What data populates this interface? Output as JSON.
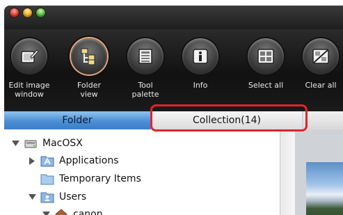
{
  "toolbar": {
    "buttons": [
      {
        "label_line1": "Edit image",
        "label_line2": "window",
        "icon": "edit-image-icon"
      },
      {
        "label_line1": "Folder",
        "label_line2": "view",
        "icon": "folder-view-icon"
      },
      {
        "label_line1": "Tool",
        "label_line2": "palette",
        "icon": "tool-palette-icon"
      },
      {
        "label_line1": "Info",
        "label_line2": "",
        "icon": "info-icon"
      },
      {
        "label_line1": "Select all",
        "label_line2": "",
        "icon": "select-all-icon"
      },
      {
        "label_line1": "Clear all",
        "label_line2": "",
        "icon": "clear-all-icon"
      }
    ]
  },
  "tabs": {
    "folder_label": "Folder",
    "collection_label": "Collection(14)"
  },
  "tree": {
    "items": [
      {
        "label": "MacOSX",
        "icon": "hard-drive-icon",
        "expanded": true
      },
      {
        "label": "Applications",
        "icon": "applications-folder-icon",
        "expanded": false
      },
      {
        "label": "Temporary Items",
        "icon": "folder-icon",
        "expanded": null
      },
      {
        "label": "Users",
        "icon": "users-folder-icon",
        "expanded": true
      },
      {
        "label": "canon",
        "icon": "home-icon",
        "expanded": true
      }
    ]
  },
  "colors": {
    "highlight": "#e2232a",
    "folder_tab": "#4d8fd4"
  }
}
